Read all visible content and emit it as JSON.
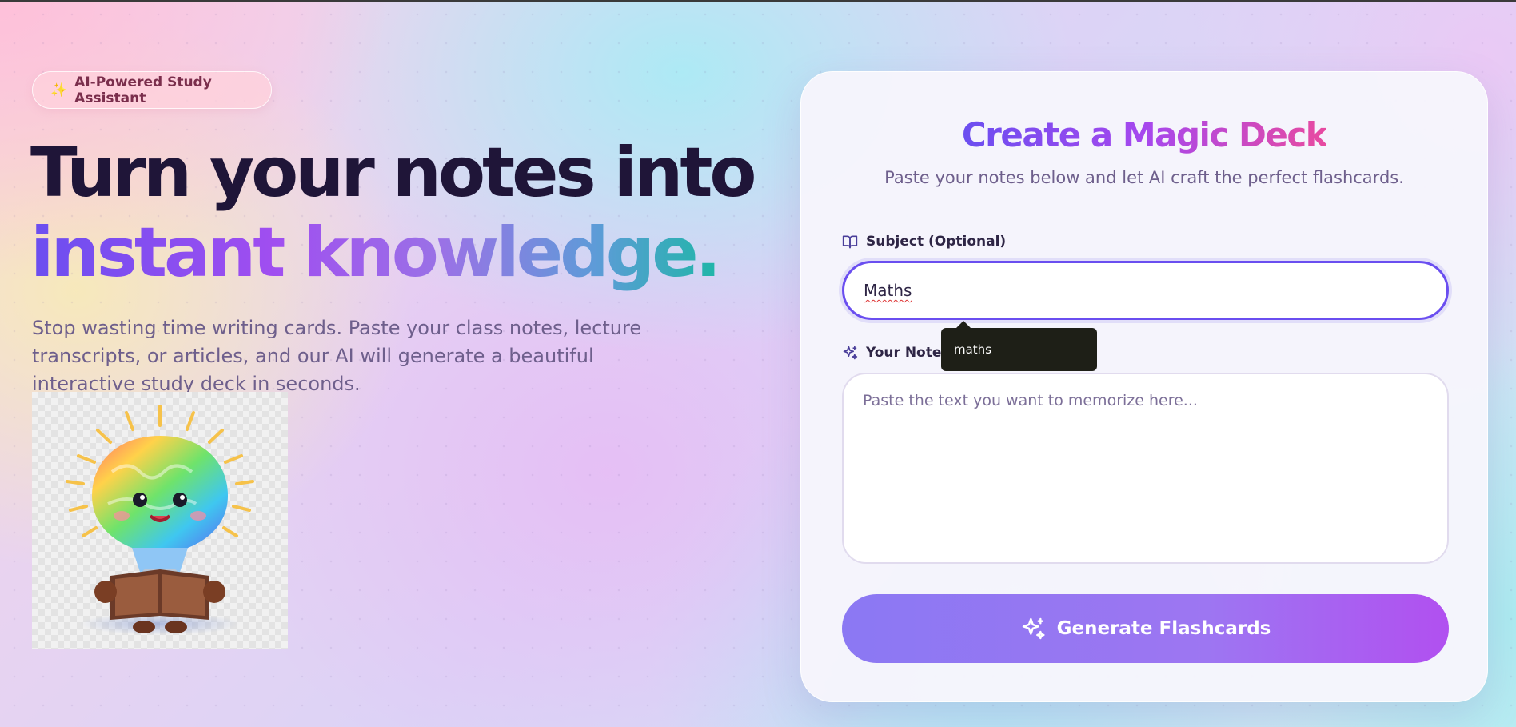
{
  "badge": {
    "icon": "sparkles-icon",
    "label": "AI-Powered Study Assistant"
  },
  "hero": {
    "headline_line1": "Turn your notes into",
    "headline_line2": "instant knowledge.",
    "description": "Stop wasting time writing cards. Paste your class notes, lecture transcripts, or articles, and our AI will generate a beautiful interactive study deck in seconds.",
    "image": "brain-lightbulb-mascot-reading-book"
  },
  "card": {
    "title": "Create a Magic Deck",
    "subtitle": "Paste your notes below and let AI craft the perfect flashcards.",
    "subject": {
      "icon": "book-open-icon",
      "label": "Subject (Optional)",
      "value": "Maths"
    },
    "autocomplete_suggestion": "maths",
    "notes": {
      "icon": "sparkles-icon",
      "label": "Your Notes",
      "value": "",
      "placeholder": "Paste the text you want to memorize here..."
    },
    "generate_button": {
      "icon": "sparkles-icon",
      "label": "Generate Flashcards"
    }
  },
  "colors": {
    "accent_purple": "#6b4ef0",
    "accent_pink": "#e84aa0",
    "headline_dark": "#1f1538",
    "button_start": "#8b78f3",
    "button_end": "#b150f0"
  }
}
